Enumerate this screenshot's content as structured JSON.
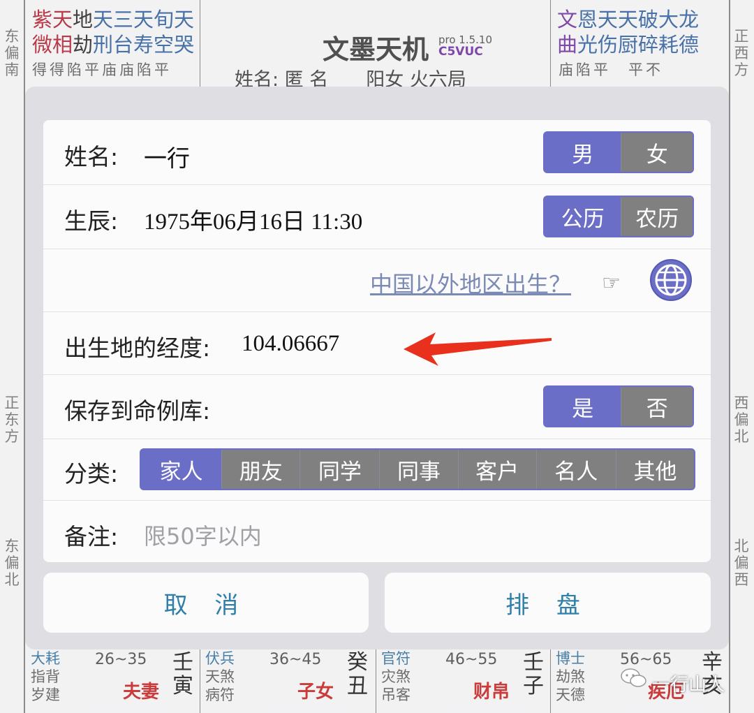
{
  "chart": {
    "app_title": "文墨天机",
    "version": "pro 1.5.10",
    "code": "C5VUC",
    "info": "姓名: 匿 名　　阳女 火六局",
    "left_directions": [
      "东偏南",
      "正东方",
      "东偏北"
    ],
    "right_directions": [
      "正西方",
      "西偏北",
      "北偏西"
    ],
    "top_left_stars_line1": [
      {
        "t": "紫天",
        "c": "red"
      },
      {
        "t": "地",
        "c": "black"
      },
      {
        "t": "天三天旬天",
        "c": "blue"
      }
    ],
    "top_left_stars_line2": [
      {
        "t": "微相",
        "c": "red"
      },
      {
        "t": "劫",
        "c": "black"
      },
      {
        "t": "刑台寿空哭",
        "c": "blue"
      }
    ],
    "top_left_brightness": "得得陷平庙庙陷平",
    "top_right_stars_line1": [
      {
        "t": "文",
        "c": "purple"
      },
      {
        "t": "恩天天破大龙",
        "c": "blue"
      }
    ],
    "top_right_stars_line2": [
      {
        "t": "曲",
        "c": "purple"
      },
      {
        "t": "光伤厨碎耗德",
        "c": "blue"
      }
    ],
    "top_right_brightness": "庙陷平　平不",
    "bottom_cells": [
      {
        "s1": "大耗",
        "s2": "指背",
        "s3": "岁建",
        "age": "26~35",
        "palace": "夫妻",
        "gz1": "壬",
        "gz2": "寅"
      },
      {
        "s1": "伏兵",
        "s2": "天煞",
        "s3": "病符",
        "age": "36~45",
        "palace": "子女",
        "gz1": "癸",
        "gz2": "丑"
      },
      {
        "s1": "官符",
        "s2": "灾煞",
        "s3": "吊客",
        "age": "46~55",
        "palace": "财帛",
        "gz1": "壬",
        "gz2": "子"
      },
      {
        "s1": "博士",
        "s2": "劫煞",
        "s3": "天德",
        "age": "56~65",
        "palace": "疾厄",
        "gz1": "辛",
        "gz2": "亥"
      }
    ],
    "watermark": "一行山人"
  },
  "form": {
    "name_label": "姓名:",
    "name_value": "一行",
    "gender_options": [
      {
        "label": "男",
        "selected": true
      },
      {
        "label": "女",
        "selected": false
      }
    ],
    "birth_label": "生辰:",
    "birth_value": "1975年06月16日 11:30",
    "calendar_options": [
      {
        "label": "公历",
        "selected": true
      },
      {
        "label": "农历",
        "selected": false
      }
    ],
    "abroad_link": "中国以外地区出生？",
    "longitude_label": "出生地的经度:",
    "longitude_value": "104.06667",
    "save_label": "保存到命例库:",
    "save_options": [
      {
        "label": "是",
        "selected": true
      },
      {
        "label": "否",
        "selected": false
      }
    ],
    "category_label": "分类:",
    "category_options": [
      {
        "label": "家人",
        "selected": true
      },
      {
        "label": "朋友",
        "selected": false
      },
      {
        "label": "同学",
        "selected": false
      },
      {
        "label": "同事",
        "selected": false
      },
      {
        "label": "客户",
        "selected": false
      },
      {
        "label": "名人",
        "selected": false
      },
      {
        "label": "其他",
        "selected": false
      }
    ],
    "notes_label": "备注:",
    "notes_placeholder": "限50字以内",
    "icons": {
      "hand": "pointing-hand-icon",
      "globe": "globe-icon",
      "arrow": "red-arrow-annotation"
    }
  },
  "buttons": {
    "cancel": "取 消",
    "submit": "排 盘"
  },
  "colors": {
    "accent": "#6b6ec7",
    "unselected": "#808080",
    "button_text": "#2f7fa9",
    "arrow": "#e8301c",
    "palace": "#c21a1a"
  }
}
